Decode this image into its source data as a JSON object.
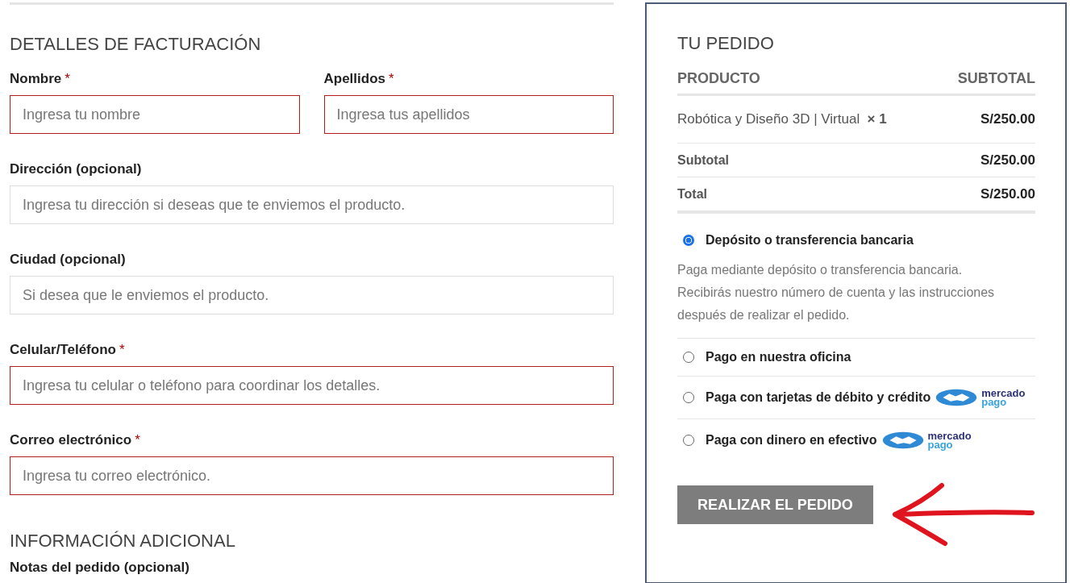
{
  "billing": {
    "title": "DETALLES DE FACTURACIÓN",
    "rows": [
      [
        {
          "label": "Nombre",
          "required_mark": "*",
          "placeholder": "Ingresa tu nombre",
          "invalid": true
        },
        {
          "label": "Apellidos",
          "required_mark": "*",
          "placeholder": "Ingresa tus apellidos",
          "invalid": true
        }
      ],
      [
        {
          "label": "Dirección (opcional)",
          "placeholder": "Ingresa tu dirección si deseas que te enviemos el producto.",
          "invalid": false
        }
      ],
      [
        {
          "label": "Ciudad (opcional)",
          "placeholder": "Si desea que le enviemos el producto.",
          "invalid": false
        }
      ],
      [
        {
          "label": "Celular/Teléfono",
          "required_mark": "*",
          "placeholder": "Ingresa tu celular o teléfono para coordinar los detalles.",
          "invalid": true
        }
      ],
      [
        {
          "label": "Correo electrónico",
          "required_mark": "*",
          "placeholder": "Ingresa tu correo electrónico.",
          "invalid": true
        }
      ]
    ]
  },
  "additional": {
    "title": "INFORMACIÓN ADICIONAL",
    "notes_label": "Notas del pedido (opcional)"
  },
  "order": {
    "title": "TU PEDIDO",
    "columns": [
      "PRODUCTO",
      "SUBTOTAL"
    ],
    "product": {
      "name": "Robótica y Diseño 3D | Virtual",
      "quantity": "× 1",
      "price": "S/250.00"
    },
    "totals": [
      {
        "label": "Subtotal",
        "value": "S/250.00"
      },
      {
        "label": "Total",
        "value": "S/250.00"
      }
    ],
    "payment_methods": [
      {
        "label": "Depósito o transferencia bancaria",
        "selected": true,
        "description": "Paga mediante depósito o transferencia bancaria. Recibirás nuestro número de cuenta y las instrucciones después de realizar el pedido."
      },
      {
        "label": "Pago en nuestra oficina",
        "selected": false
      },
      {
        "label": "Paga con tarjetas de débito y crédito",
        "selected": false,
        "logo": [
          "mercado",
          "pago"
        ]
      },
      {
        "label": "Paga con dinero en efectivo",
        "selected": false,
        "logo": [
          "mercado",
          "pago"
        ]
      }
    ],
    "place_order_button": "REALIZAR EL PEDIDO"
  }
}
